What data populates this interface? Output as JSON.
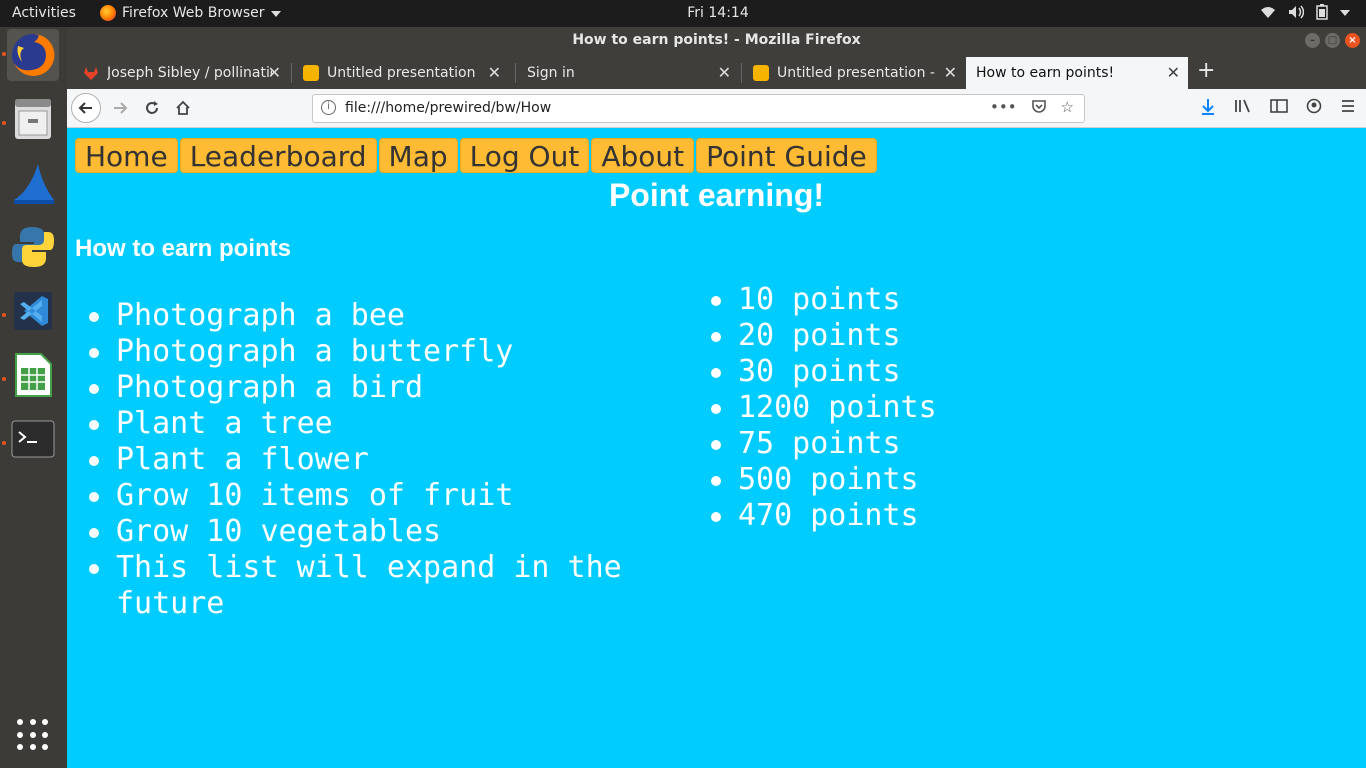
{
  "topbar": {
    "activities": "Activities",
    "app_name": "Firefox Web Browser",
    "clock": "Fri 14:14"
  },
  "window": {
    "title": "How to earn points! - Mozilla Firefox"
  },
  "tabs": [
    {
      "label": "Joseph Sibley / pollinatio"
    },
    {
      "label": "Untitled presentation - G"
    },
    {
      "label": "Sign in"
    },
    {
      "label": "Untitled presentation - G"
    },
    {
      "label": "How to earn points!"
    }
  ],
  "navbar": {
    "url": "file:///home/prewired/bw/How"
  },
  "page": {
    "menu": [
      "Home",
      "Leaderboard",
      "Map",
      "Log Out",
      "About",
      "Point Guide"
    ],
    "heading": "Point earning!",
    "subheading": "How to earn points",
    "activities": [
      "Photograph a bee",
      "Photograph a butterfly",
      "Photograph a bird",
      "Plant a tree",
      "Plant a flower",
      "Grow 10 items of fruit",
      "Grow 10 vegetables",
      "This list will expand in the future"
    ],
    "points": [
      "10 points",
      "20 points",
      "30 points",
      "1200 points",
      "75 points",
      "500 points",
      "470 points"
    ]
  },
  "colors": {
    "page_bg": "#00ccff",
    "menu_bg": "#ffbb33"
  }
}
